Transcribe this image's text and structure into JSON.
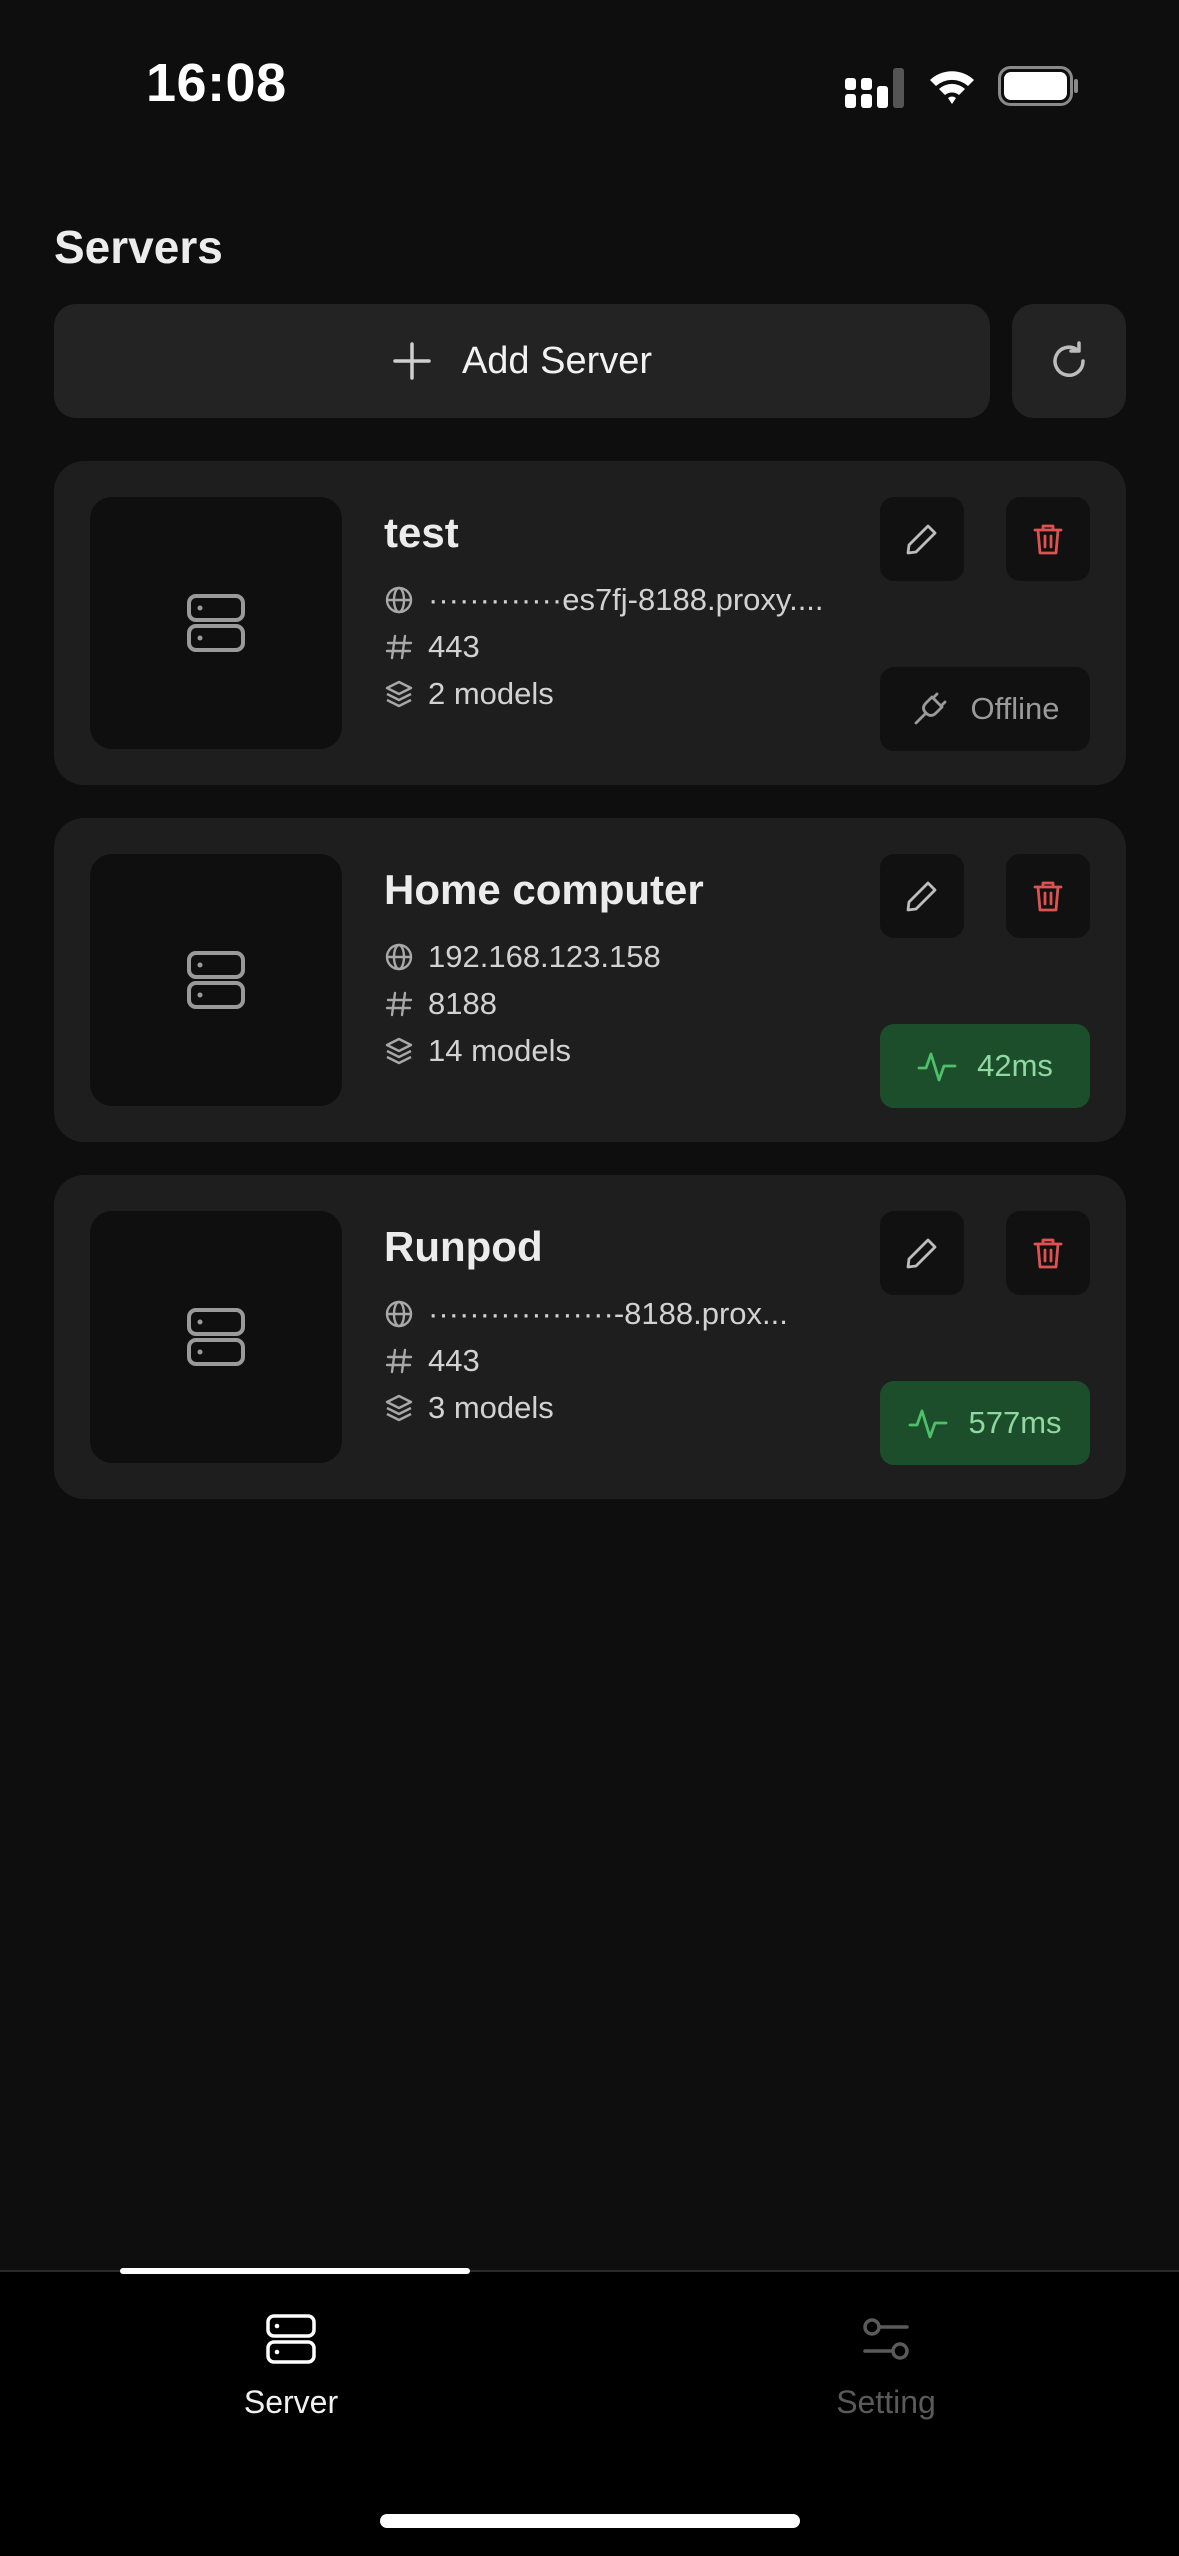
{
  "status_bar": {
    "time": "16:08"
  },
  "header": {
    "title": "Servers"
  },
  "toolbar": {
    "add_label": "Add Server",
    "refresh_icon": "refresh-icon"
  },
  "servers": [
    {
      "name": "test",
      "address": "·············es7fj-8188.proxy....",
      "port": "443",
      "models": "2 models",
      "status": "Offline",
      "status_kind": "offline"
    },
    {
      "name": "Home computer",
      "address": "192.168.123.158",
      "port": "8188",
      "models": "14 models",
      "status": "42ms",
      "status_kind": "online"
    },
    {
      "name": "Runpod",
      "address": "··················-8188.prox...",
      "port": "443",
      "models": "3 models",
      "status": "577ms",
      "status_kind": "online"
    }
  ],
  "tabs": [
    {
      "label": "Server",
      "active": true
    },
    {
      "label": "Setting",
      "active": false
    }
  ],
  "colors": {
    "background": "#0e0e0e",
    "card": "#1e1e1e",
    "online": "#1d4e2b",
    "online_text": "#8fd8a0",
    "danger": "#e05252"
  }
}
